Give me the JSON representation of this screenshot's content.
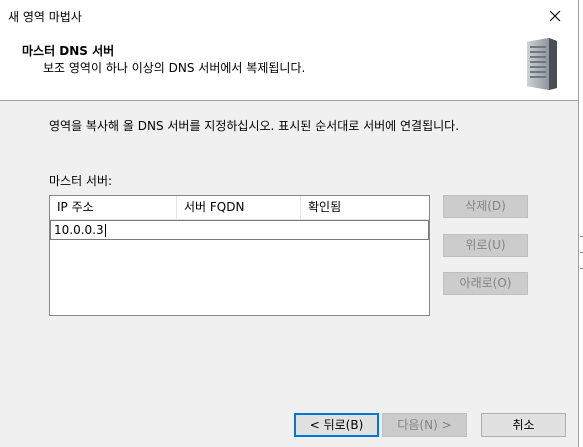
{
  "window": {
    "title": "새 영역 마법사"
  },
  "header": {
    "title": "마스터 DNS 서버",
    "subtitle": "보조 영역이 하나 이상의 DNS 서버에서 복제됩니다.",
    "icon": "server-icon"
  },
  "body": {
    "instruction": "영역을 복사해 올 DNS 서버를 지정하십시오. 표시된 순서대로 서버에 연결됩니다.",
    "list_label": "마스터 서버:",
    "columns": [
      "IP 주소",
      "서버 FQDN",
      "확인됨"
    ],
    "rows": [
      {
        "ip": "10.0.0.3",
        "fqdn": "",
        "validated": ""
      }
    ]
  },
  "side_buttons": {
    "delete": "삭제(D)",
    "up": "위로(U)",
    "down": "아래로(O)"
  },
  "footer": {
    "back": "< 뒤로(B)",
    "next": "다음(N) >",
    "cancel": "취소"
  },
  "colors": {
    "focus": "#0078d7",
    "disabled_text": "#838383"
  }
}
